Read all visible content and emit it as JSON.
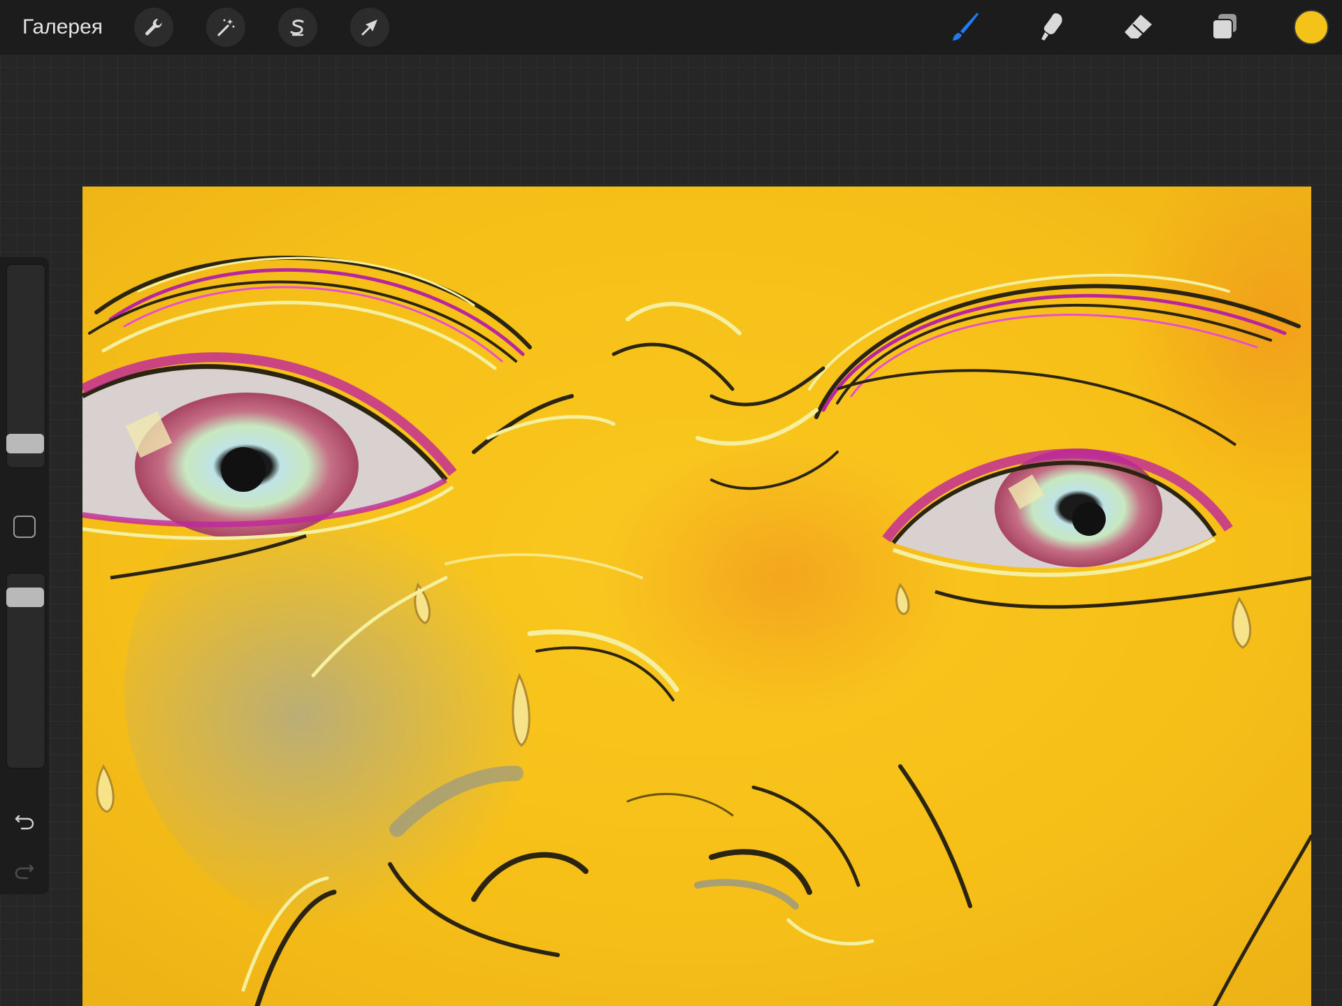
{
  "topbar": {
    "gallery_label": "Галерея",
    "left_tools": [
      {
        "name": "actions",
        "icon": "wrench-icon"
      },
      {
        "name": "adjustments",
        "icon": "magic-wand-icon"
      },
      {
        "name": "selection",
        "icon": "selection-s-icon"
      },
      {
        "name": "transform",
        "icon": "arrow-cursor-icon"
      }
    ],
    "right_tools": [
      {
        "name": "brush",
        "icon": "brush-icon",
        "active": true
      },
      {
        "name": "smudge",
        "icon": "smudge-finger-icon",
        "active": false
      },
      {
        "name": "eraser",
        "icon": "eraser-icon",
        "active": false
      },
      {
        "name": "layers",
        "icon": "layers-icon",
        "active": false
      }
    ],
    "current_color": "#f4c319",
    "active_tool_color": "#1e7cf0"
  },
  "sidebar": {
    "brush_size_level": 0.06,
    "brush_opacity_level": 0.93,
    "icons": [
      "modify-square-icon",
      "undo-icon",
      "redo-icon"
    ]
  },
  "canvas": {
    "background_color": "#f7c21d",
    "subject": "painting-crying-face"
  }
}
